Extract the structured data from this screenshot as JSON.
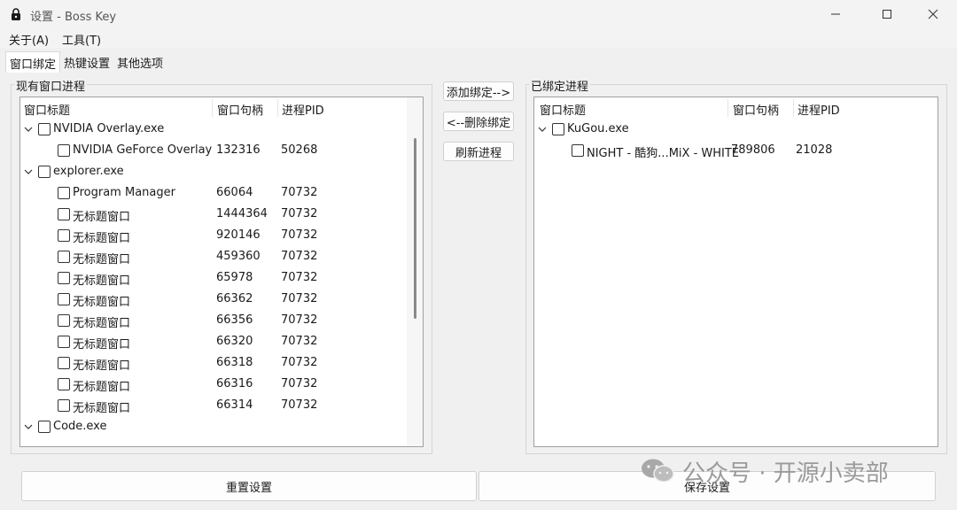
{
  "window": {
    "title": "设置 - Boss Key"
  },
  "menu": [
    "关于(A)",
    "工具(T)"
  ],
  "tabs": [
    "窗口绑定",
    "热键设置",
    "其他选项"
  ],
  "left_panel": {
    "group_label": "现有窗口进程",
    "columns": [
      "窗口标题",
      "窗口句柄",
      "进程PID"
    ],
    "rows": [
      {
        "kind": "group",
        "title": "NVIDIA Overlay.exe",
        "handle": "",
        "pid": ""
      },
      {
        "kind": "child",
        "title": "NVIDIA GeForce Overlay",
        "handle": "132316",
        "pid": "50268"
      },
      {
        "kind": "group",
        "title": "explorer.exe",
        "handle": "",
        "pid": ""
      },
      {
        "kind": "child",
        "title": "Program Manager",
        "handle": "66064",
        "pid": "70732"
      },
      {
        "kind": "child",
        "title": "无标题窗口",
        "handle": "1444364",
        "pid": "70732"
      },
      {
        "kind": "child",
        "title": "无标题窗口",
        "handle": "920146",
        "pid": "70732"
      },
      {
        "kind": "child",
        "title": "无标题窗口",
        "handle": "459360",
        "pid": "70732"
      },
      {
        "kind": "child",
        "title": "无标题窗口",
        "handle": "65978",
        "pid": "70732"
      },
      {
        "kind": "child",
        "title": "无标题窗口",
        "handle": "66362",
        "pid": "70732"
      },
      {
        "kind": "child",
        "title": "无标题窗口",
        "handle": "66356",
        "pid": "70732"
      },
      {
        "kind": "child",
        "title": "无标题窗口",
        "handle": "66320",
        "pid": "70732"
      },
      {
        "kind": "child",
        "title": "无标题窗口",
        "handle": "66318",
        "pid": "70732"
      },
      {
        "kind": "child",
        "title": "无标题窗口",
        "handle": "66316",
        "pid": "70732"
      },
      {
        "kind": "child",
        "title": "无标题窗口",
        "handle": "66314",
        "pid": "70732"
      },
      {
        "kind": "group",
        "title": "Code.exe",
        "handle": "",
        "pid": ""
      }
    ]
  },
  "middle_buttons": {
    "add": "添加绑定-->",
    "remove": "<--删除绑定",
    "refresh": "刷新进程"
  },
  "right_panel": {
    "group_label": "已绑定进程",
    "columns": [
      "窗口标题",
      "窗口句柄",
      "进程PID"
    ],
    "rows": [
      {
        "kind": "group",
        "title": "KuGou.exe",
        "handle": "",
        "pid": ""
      },
      {
        "kind": "child",
        "title": "NIGHT - 酷狗...MiX - WHITE",
        "handle": "789806",
        "pid": "21028"
      }
    ]
  },
  "footer": {
    "reset": "重置设置",
    "save": "保存设置"
  },
  "watermark": {
    "text": "公众号 · 开源小卖部"
  }
}
